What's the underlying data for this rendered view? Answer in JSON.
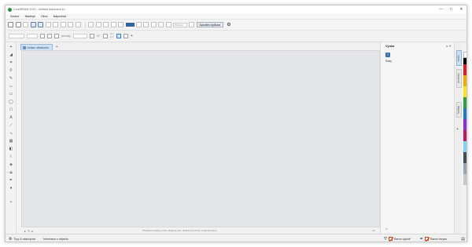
{
  "window": {
    "title": "CorelDRAW 2019 - Untitled dokument-ku",
    "controls": [
      "—",
      "□",
      "✕"
    ]
  },
  "menu": {
    "items": [
      "Soubor",
      "Nástroje",
      "Okno",
      "Nápověda"
    ]
  },
  "toolbar": {
    "accent_color": "#1a6fb8",
    "snap_label": "Přichytit",
    "launcher_label": "Spouštěcí aplikace"
  },
  "propbar": {
    "units_label": "jednotky",
    "angle": "90°",
    "nudge_top": "0,1\"",
    "nudge_bottom": "0,1\""
  },
  "document": {
    "tab_label": "Uvítací obrazovka"
  },
  "canvas_status": {
    "message": "Přetažením barvy (nebo objektu) sem uložíte tuto barvu s dokumentem"
  },
  "panel": {
    "title": "Výuka",
    "hint_label": "Rady"
  },
  "dock_tabs": [
    "Výuka",
    "Vlastnosti",
    "Objekty"
  ],
  "palette_colors": [
    "#ffffff",
    "#000000",
    "#e01b24",
    "#f6a800",
    "#fbe51a",
    "#2ea043",
    "#1f78c8",
    "#8a2be2",
    "#c2185b",
    "#7fd3f7",
    "#444c56",
    "#9aa3b0",
    "#c3c8cf"
  ],
  "status": {
    "tips_label": "Tipy & nástrojové",
    "info_label": "Informace o objektu",
    "fill_label": "Barva výplně",
    "outline_label": "Barva obrysu"
  }
}
